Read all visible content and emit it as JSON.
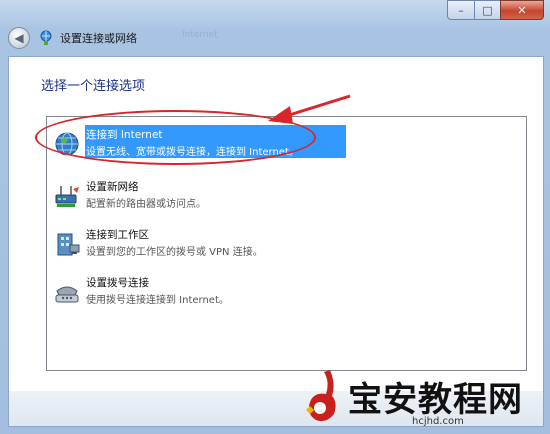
{
  "window": {
    "title": "设置连接或网络",
    "ghost_text": "Internet"
  },
  "caption": {
    "minimize": "–",
    "maximize": "□",
    "close": "✕"
  },
  "main": {
    "heading": "选择一个连接选项",
    "options": [
      {
        "title": "连接到 Internet",
        "desc": "设置无线、宽带或拨号连接，连接到 Internet。",
        "icon": "globe-icon",
        "selected": true
      },
      {
        "title": "设置新网络",
        "desc": "配置新的路由器或访问点。",
        "icon": "router-icon",
        "selected": false
      },
      {
        "title": "连接到工作区",
        "desc": "设置到您的工作区的拨号或 VPN 连接。",
        "icon": "workplace-icon",
        "selected": false
      },
      {
        "title": "设置拨号连接",
        "desc": "使用拨号连接连接到 Internet。",
        "icon": "phone-modem-icon",
        "selected": false
      }
    ]
  },
  "annotation": {
    "arrow_color": "#d8262a",
    "ellipse_color": "#d8262a"
  },
  "colors": {
    "selection": "#3399ff",
    "heading": "#1e3287"
  },
  "watermark": {
    "text": "宝安教程网",
    "url": "hcjhd.com"
  }
}
